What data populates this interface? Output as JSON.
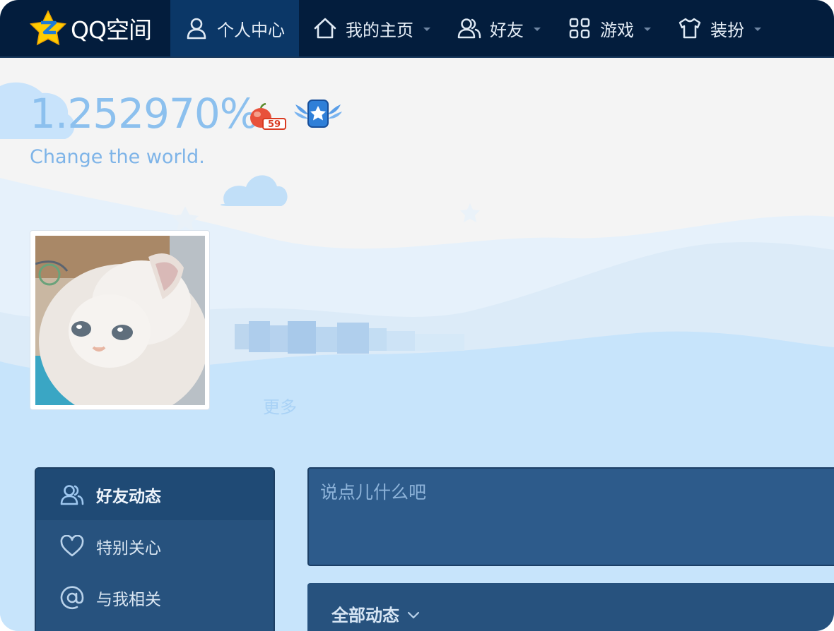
{
  "app": {
    "logo_text": "QQ空间"
  },
  "nav": {
    "items": [
      {
        "label": "个人中心",
        "icon": "person-icon",
        "active": true,
        "dropdown": false
      },
      {
        "label": "我的主页",
        "icon": "home-icon",
        "active": false,
        "dropdown": true
      },
      {
        "label": "好友",
        "icon": "friends-icon",
        "active": false,
        "dropdown": true
      },
      {
        "label": "游戏",
        "icon": "grid-icon",
        "active": false,
        "dropdown": true
      },
      {
        "label": "装扮",
        "icon": "shirt-icon",
        "active": false,
        "dropdown": true
      }
    ]
  },
  "profile": {
    "percent": "1.252970%",
    "slogan": "Change the world.",
    "level_badge": "59",
    "more_label": "更多"
  },
  "sidemenu": {
    "items": [
      {
        "label": "好友动态",
        "icon": "friends-icon",
        "active": true
      },
      {
        "label": "特别关心",
        "icon": "heart-icon",
        "active": false
      },
      {
        "label": "与我相关",
        "icon": "at-icon",
        "active": false
      }
    ]
  },
  "composer": {
    "placeholder": "说点儿什么吧"
  },
  "feed": {
    "filter_label": "全部动态"
  },
  "colors": {
    "nav_bg": "#031d3d",
    "nav_active": "#0b3767",
    "panel": "#27527e",
    "accent_text": "#8cc0ee",
    "sky": "#c4e3fb"
  }
}
